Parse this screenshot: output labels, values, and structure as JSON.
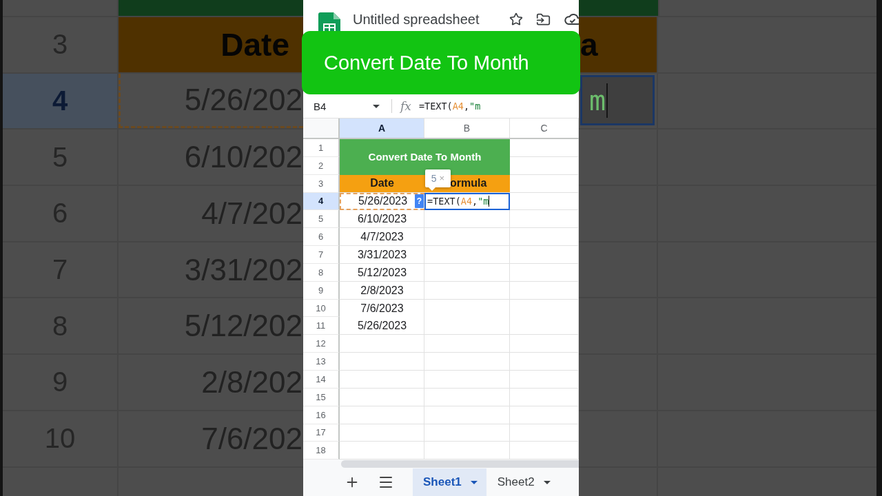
{
  "backdrop": {
    "left_rows": [
      {
        "number": "3",
        "selected": false,
        "cell": {
          "kind": "header",
          "text": "Date"
        }
      },
      {
        "number": "4",
        "selected": true,
        "cell": {
          "kind": "date",
          "text": "5/26/202",
          "referenced": true
        }
      },
      {
        "number": "5",
        "selected": false,
        "cell": {
          "kind": "date",
          "text": "6/10/202",
          "referenced": false
        }
      },
      {
        "number": "6",
        "selected": false,
        "cell": {
          "kind": "date",
          "text": "4/7/202",
          "referenced": false
        }
      },
      {
        "number": "7",
        "selected": false,
        "cell": {
          "kind": "date",
          "text": "3/31/202",
          "referenced": false
        }
      },
      {
        "number": "8",
        "selected": false,
        "cell": {
          "kind": "date",
          "text": "5/12/202",
          "referenced": false
        }
      },
      {
        "number": "9",
        "selected": false,
        "cell": {
          "kind": "date",
          "text": "2/8/202",
          "referenced": false
        }
      },
      {
        "number": "10",
        "selected": false,
        "cell": {
          "kind": "date",
          "text": "7/6/202",
          "referenced": false
        }
      }
    ],
    "right_rows": [
      {
        "kind": "header",
        "text": "a"
      },
      {
        "kind": "editor",
        "text": "m"
      }
    ]
  },
  "document": {
    "title": "Untitled spreadsheet"
  },
  "banner": {
    "text": "Convert Date To Month"
  },
  "formula_bar": {
    "name_box": "B4",
    "fx": "fx",
    "formula": [
      {
        "kind": "plain",
        "text": "=TEXT("
      },
      {
        "kind": "reference",
        "text": "A4"
      },
      {
        "kind": "plain",
        "text": ","
      },
      {
        "kind": "string",
        "text": "\"m"
      }
    ]
  },
  "columns": [
    {
      "label": "A",
      "selected": true
    },
    {
      "label": "B",
      "selected": false
    },
    {
      "label": "C",
      "selected": false
    }
  ],
  "grid": {
    "merged_title": "Convert Date To Month",
    "rows": [
      {
        "number": "1",
        "selected": false
      },
      {
        "number": "2",
        "selected": false
      },
      {
        "number": "3",
        "selected": false,
        "cells": [
          {
            "kind": "header",
            "text": "Date"
          },
          {
            "kind": "header",
            "text": "ormula",
            "tooltip": {
              "count": "5",
              "close": "×"
            }
          }
        ]
      },
      {
        "number": "4",
        "selected": true,
        "cells": [
          {
            "kind": "date",
            "text": "5/26/2023",
            "referenced": true
          },
          {
            "kind": "editor",
            "help": "?",
            "formula": [
              {
                "kind": "plain",
                "text": "=TEXT("
              },
              {
                "kind": "reference",
                "text": "A4"
              },
              {
                "kind": "plain",
                "text": ","
              },
              {
                "kind": "string",
                "text": "\"m"
              }
            ]
          }
        ]
      },
      {
        "number": "5",
        "selected": false,
        "cells": [
          {
            "kind": "date",
            "text": "6/10/2023",
            "referenced": false
          }
        ]
      },
      {
        "number": "6",
        "selected": false,
        "cells": [
          {
            "kind": "date",
            "text": "4/7/2023",
            "referenced": false
          }
        ]
      },
      {
        "number": "7",
        "selected": false,
        "cells": [
          {
            "kind": "date",
            "text": "3/31/2023",
            "referenced": false
          }
        ]
      },
      {
        "number": "8",
        "selected": false,
        "cells": [
          {
            "kind": "date",
            "text": "5/12/2023",
            "referenced": false
          }
        ]
      },
      {
        "number": "9",
        "selected": false,
        "cells": [
          {
            "kind": "date",
            "text": "2/8/2023",
            "referenced": false
          }
        ]
      },
      {
        "number": "10",
        "selected": false,
        "cells": [
          {
            "kind": "date",
            "text": "7/6/2023",
            "referenced": false
          }
        ]
      },
      {
        "number": "11",
        "selected": false,
        "cells": [
          {
            "kind": "date",
            "text": "5/26/2023",
            "referenced": false
          }
        ]
      },
      {
        "number": "12",
        "selected": false
      },
      {
        "number": "13",
        "selected": false
      },
      {
        "number": "14",
        "selected": false
      },
      {
        "number": "15",
        "selected": false
      },
      {
        "number": "16",
        "selected": false
      },
      {
        "number": "17",
        "selected": false
      },
      {
        "number": "18",
        "selected": false
      }
    ]
  },
  "sheet_tabs": [
    {
      "label": "Sheet1",
      "selected": true
    },
    {
      "label": "Sheet2",
      "selected": false
    }
  ]
}
